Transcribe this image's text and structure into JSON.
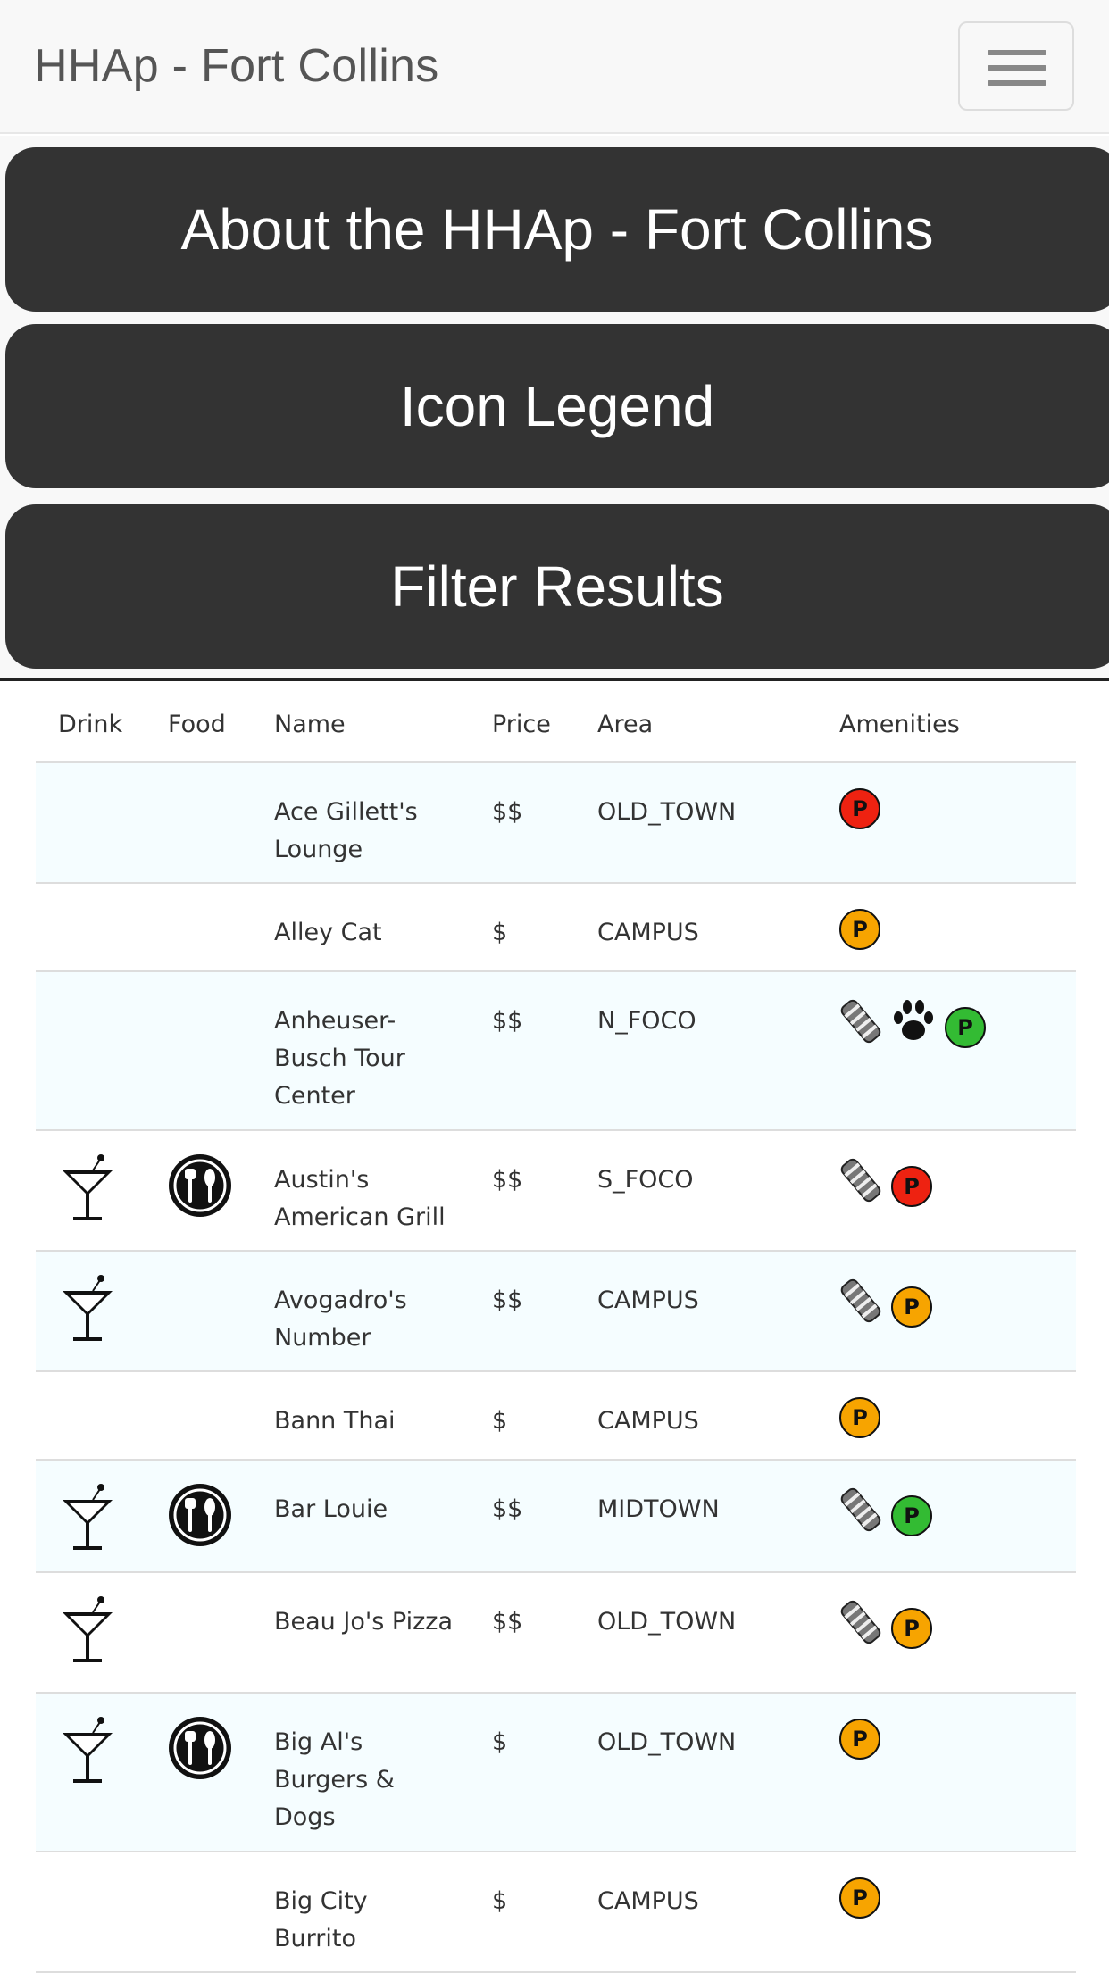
{
  "navbar": {
    "brand": "HHAp - Fort Collins",
    "menu_icon": "hamburger-menu-icon"
  },
  "buttons": {
    "about": "About the HHAp - Fort Collins",
    "legend": "Icon Legend",
    "filter": "Filter Results"
  },
  "table": {
    "headers": {
      "drink": "Drink",
      "food": "Food",
      "name": "Name",
      "price": "Price",
      "area": "Area",
      "amenities": "Amenities"
    },
    "rows": [
      {
        "name": "Ace Gillett's Lounge",
        "price": "$$",
        "area": "OLD_TOWN",
        "drink": false,
        "food": false,
        "amenities": [
          "parking-red"
        ]
      },
      {
        "name": "Alley Cat",
        "price": "$",
        "area": "CAMPUS",
        "drink": false,
        "food": false,
        "amenities": [
          "parking-orange"
        ]
      },
      {
        "name": "Anheuser-Busch Tour Center",
        "price": "$$",
        "area": "N_FOCO",
        "drink": false,
        "food": false,
        "amenities": [
          "patio",
          "pets",
          "parking-green"
        ]
      },
      {
        "name": "Austin's American Grill",
        "price": "$$",
        "area": "S_FOCO",
        "drink": true,
        "food": true,
        "amenities": [
          "patio",
          "parking-red"
        ]
      },
      {
        "name": "Avogadro's Number",
        "price": "$$",
        "area": "CAMPUS",
        "drink": true,
        "food": false,
        "amenities": [
          "patio",
          "parking-orange"
        ]
      },
      {
        "name": "Bann Thai",
        "price": "$",
        "area": "CAMPUS",
        "drink": false,
        "food": false,
        "amenities": [
          "parking-orange"
        ]
      },
      {
        "name": "Bar Louie",
        "price": "$$",
        "area": "MIDTOWN",
        "drink": true,
        "food": true,
        "amenities": [
          "patio",
          "parking-green"
        ]
      },
      {
        "name": "Beau Jo's Pizza",
        "price": "$$",
        "area": "OLD_TOWN",
        "drink": true,
        "food": false,
        "amenities": [
          "patio",
          "parking-orange"
        ]
      },
      {
        "name": "Big Al's Burgers & Dogs",
        "price": "$",
        "area": "OLD_TOWN",
        "drink": true,
        "food": true,
        "amenities": [
          "parking-orange"
        ]
      },
      {
        "name": "Big City Burrito",
        "price": "$",
        "area": "CAMPUS",
        "drink": false,
        "food": false,
        "amenities": [
          "parking-orange"
        ]
      }
    ]
  },
  "icons": {
    "drink": "martini-glass-icon",
    "food": "plate-fork-knife-icon",
    "patio": "striped-patio-icon",
    "pets": "paw-print-icon",
    "parking_label": "P"
  },
  "colors": {
    "button_bg": "#333333",
    "row_alt": "#f5fdff",
    "parking_red": "#ee2211",
    "parking_orange": "#f7a400",
    "parking_green": "#33bb33"
  }
}
